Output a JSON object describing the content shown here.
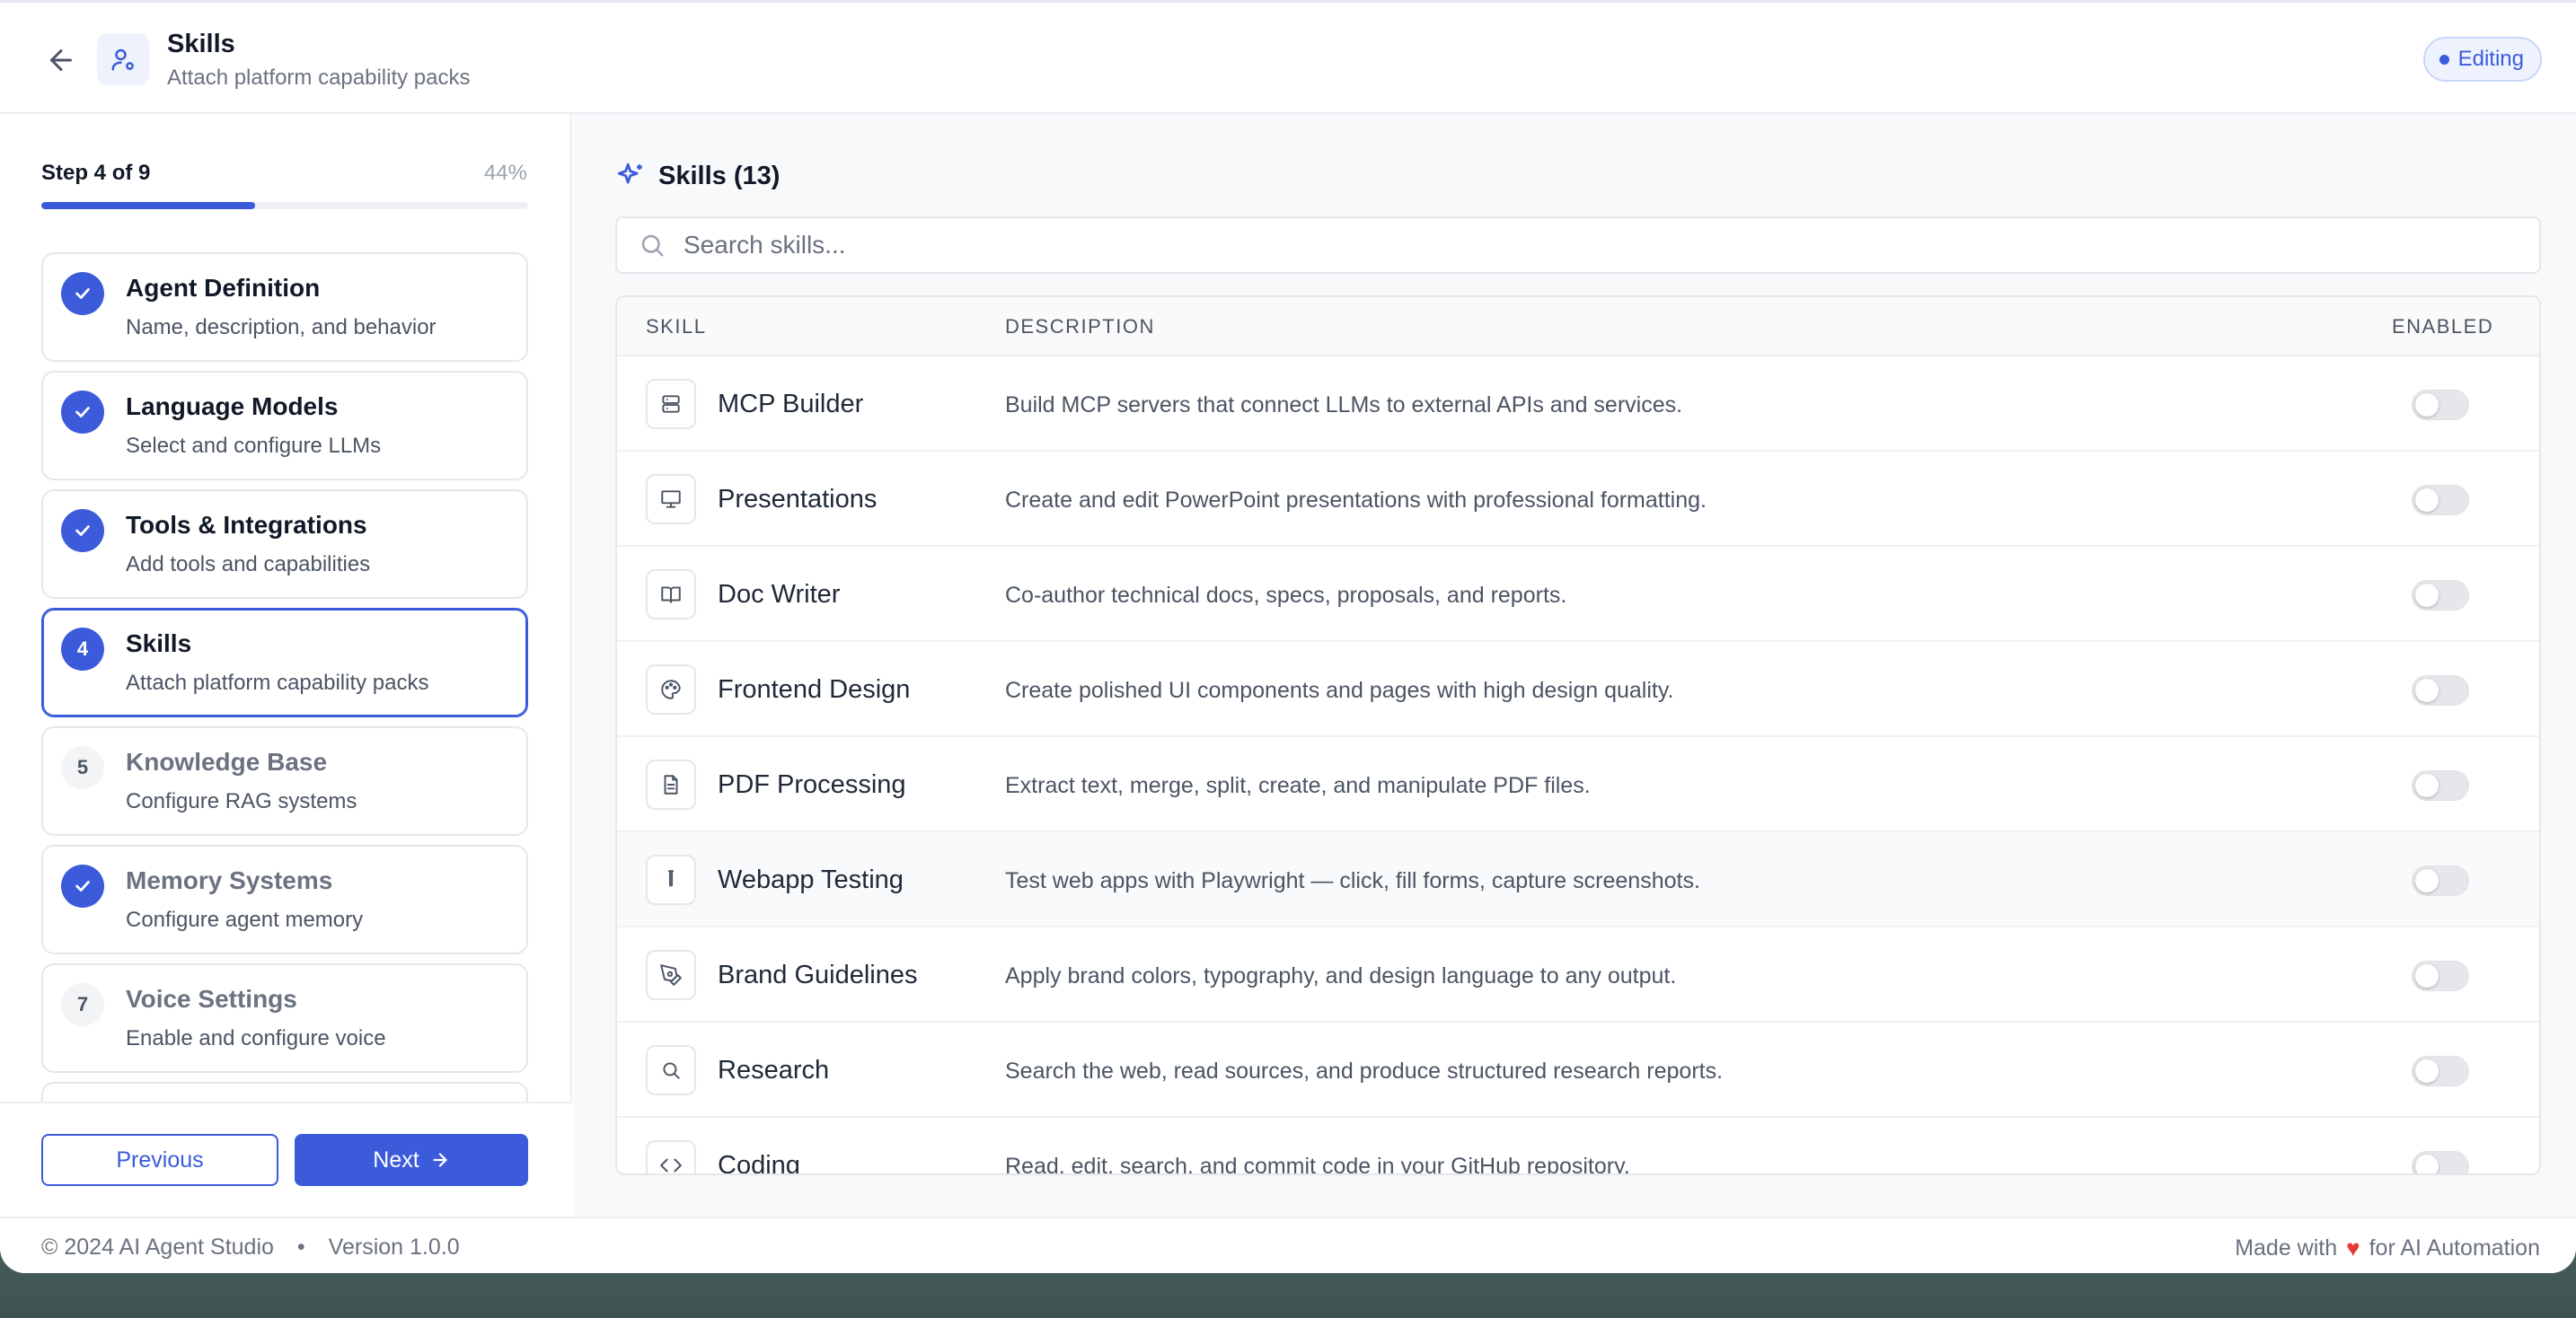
{
  "header": {
    "title": "Skills",
    "subtitle": "Attach platform capability packs",
    "badge": "Editing"
  },
  "sidebar": {
    "step_label": "Step 4 of 9",
    "progress_text": "44%",
    "progress_fraction": 0.44,
    "steps": [
      {
        "badge": "✓",
        "state": "done",
        "title": "Agent Definition",
        "desc": "Name, description, and behavior"
      },
      {
        "badge": "✓",
        "state": "done",
        "title": "Language Models",
        "desc": "Select and configure LLMs"
      },
      {
        "badge": "✓",
        "state": "done",
        "title": "Tools & Integrations",
        "desc": "Add tools and capabilities"
      },
      {
        "badge": "4",
        "state": "current",
        "title": "Skills",
        "desc": "Attach platform capability packs"
      },
      {
        "badge": "5",
        "state": "todo",
        "title": "Knowledge Base",
        "desc": "Configure RAG systems"
      },
      {
        "badge": "✓",
        "state": "done-muted",
        "title": "Memory Systems",
        "desc": "Configure agent memory"
      },
      {
        "badge": "7",
        "state": "todo",
        "title": "Voice Settings",
        "desc": "Enable and configure voice"
      }
    ],
    "prev_label": "Previous",
    "next_label": "Next"
  },
  "main": {
    "title": "Skills (13)",
    "search_placeholder": "Search skills...",
    "columns": {
      "skill": "SKILL",
      "description": "DESCRIPTION",
      "enabled": "ENABLED"
    },
    "rows": [
      {
        "icon": "server-icon",
        "name": "MCP Builder",
        "desc": "Build MCP servers that connect LLMs to external APIs and services.",
        "enabled": false
      },
      {
        "icon": "presentation-icon",
        "name": "Presentations",
        "desc": "Create and edit PowerPoint presentations with professional formatting.",
        "enabled": false
      },
      {
        "icon": "book-icon",
        "name": "Doc Writer",
        "desc": "Co-author technical docs, specs, proposals, and reports.",
        "enabled": false
      },
      {
        "icon": "palette-icon",
        "name": "Frontend Design",
        "desc": "Create polished UI components and pages with high design quality.",
        "enabled": false
      },
      {
        "icon": "file-text-icon",
        "name": "PDF Processing",
        "desc": "Extract text, merge, split, create, and manipulate PDF files.",
        "enabled": false
      },
      {
        "icon": "test-tube-icon",
        "name": "Webapp Testing",
        "desc": "Test web apps with Playwright — click, fill forms, capture screenshots.",
        "enabled": false
      },
      {
        "icon": "pen-tool-icon",
        "name": "Brand Guidelines",
        "desc": "Apply brand colors, typography, and design language to any output.",
        "enabled": false
      },
      {
        "icon": "search-icon",
        "name": "Research",
        "desc": "Search the web, read sources, and produce structured research reports.",
        "enabled": false
      },
      {
        "icon": "code-icon",
        "name": "Coding",
        "desc": "Read, edit, search, and commit code in your GitHub repository.",
        "enabled": false
      }
    ]
  },
  "footer": {
    "copyright": "© 2024 AI Agent Studio",
    "separator": "•",
    "version": "Version 1.0.0",
    "made_with": "Made with",
    "heart": "♥",
    "for_text": "for AI Automation"
  },
  "colors": {
    "accent": "#3b5bdb",
    "heart": "#e53935"
  }
}
